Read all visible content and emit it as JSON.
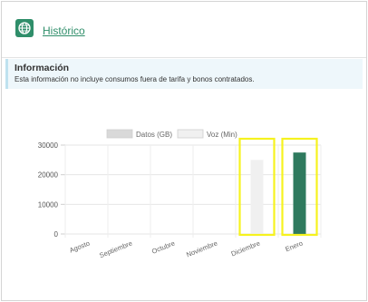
{
  "header": {
    "link_label": "Histórico",
    "icon": "globe-icon"
  },
  "info": {
    "title": "Información",
    "text": "Esta información no incluye consumos fuera de tarifa y bonos contratados."
  },
  "colors": {
    "accent": "#2f8e6a",
    "highlight": "#f6f21f",
    "datos_fill": "#d9d9d9",
    "voz_fill": "#f0f0f0",
    "enero_fill": "#2f7a5e"
  },
  "chart_data": {
    "type": "bar",
    "categories": [
      "Agosto",
      "Septiembre",
      "Octubre",
      "Noviembre",
      "Diciembre",
      "Enero"
    ],
    "series": [
      {
        "name": "Datos (GB)",
        "values": [
          0,
          0,
          0,
          0,
          0,
          0
        ]
      },
      {
        "name": "Voz (Min)",
        "values": [
          0,
          0,
          0,
          0,
          25000,
          27500
        ]
      }
    ],
    "ylim": [
      0,
      30000
    ],
    "yticks": [
      "0",
      "10000",
      "20000",
      "30000"
    ],
    "legend": "top",
    "grid": true,
    "highlighted_categories": [
      "Diciembre",
      "Enero"
    ]
  }
}
